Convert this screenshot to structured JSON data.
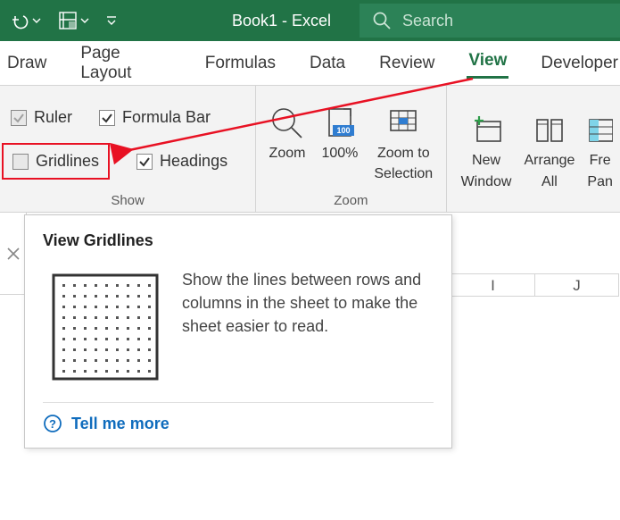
{
  "titlebar": {
    "title": "Book1  -  Excel",
    "search_placeholder": "Search"
  },
  "tabs": [
    {
      "label": "Draw",
      "active": false
    },
    {
      "label": "Page Layout",
      "active": false
    },
    {
      "label": "Formulas",
      "active": false
    },
    {
      "label": "Data",
      "active": false
    },
    {
      "label": "Review",
      "active": false
    },
    {
      "label": "View",
      "active": true
    },
    {
      "label": "Developer",
      "active": false
    }
  ],
  "ribbon": {
    "show": {
      "ruler": "Ruler",
      "formula_bar": "Formula Bar",
      "gridlines": "Gridlines",
      "headings": "Headings",
      "group_label": "Show"
    },
    "zoom": {
      "zoom": "Zoom",
      "hundred": "100%",
      "selection_l1": "Zoom to",
      "selection_l2": "Selection",
      "group_label": "Zoom"
    },
    "window": {
      "new_l1": "New",
      "new_l2": "Window",
      "arrange_l1": "Arrange",
      "arrange_l2": "All",
      "freeze_l1": "Fre",
      "freeze_l2": "Pan"
    }
  },
  "sheet": {
    "columns": [
      "I",
      "J"
    ]
  },
  "tooltip": {
    "title": "View Gridlines",
    "description": "Show the lines between rows and columns in the sheet to make the sheet easier to read.",
    "tell_more": "Tell me more"
  },
  "colors": {
    "brand": "#217346",
    "accent_red": "#e81123",
    "link": "#0f6cbd"
  }
}
